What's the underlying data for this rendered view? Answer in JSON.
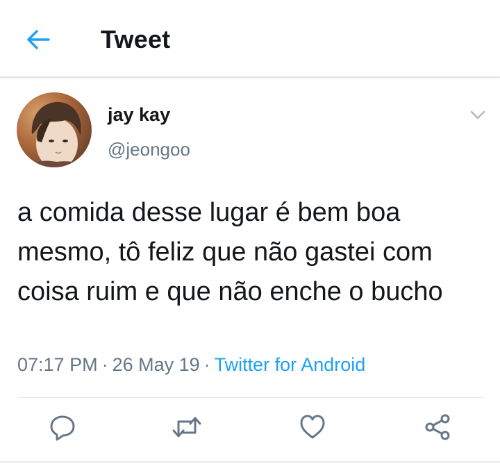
{
  "header": {
    "title": "Tweet",
    "back_icon": "arrow-left-icon"
  },
  "colors": {
    "accent": "#1da1f2",
    "text_primary": "#14171a",
    "text_secondary": "#657786",
    "divider": "#e1e8ed"
  },
  "tweet": {
    "author": {
      "display_name": "jay kay",
      "username": "@jeongoo",
      "avatar_icon": "profile-avatar"
    },
    "menu_icon": "chevron-down-icon",
    "text": "a comida desse lugar é bem boa mesmo, tô feliz que não gastei com coisa ruim e que não enche o bucho",
    "time": "07:17 PM",
    "separator": "·",
    "date": "26 May 19",
    "source": "Twitter for Android"
  },
  "actions": [
    {
      "icon": "reply-icon"
    },
    {
      "icon": "retweet-icon"
    },
    {
      "icon": "heart-icon"
    },
    {
      "icon": "share-icon"
    }
  ]
}
